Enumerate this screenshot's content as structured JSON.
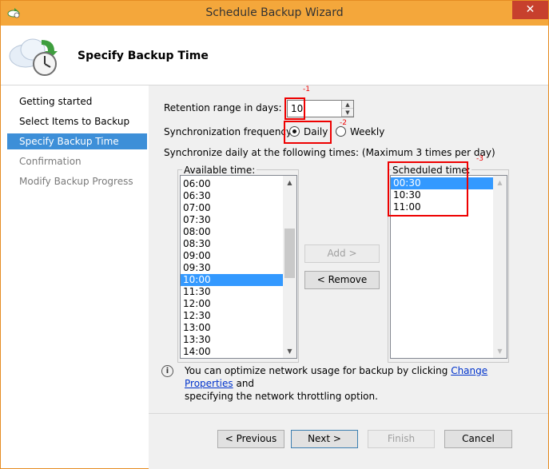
{
  "window": {
    "title": "Schedule Backup Wizard",
    "close_glyph": "✕",
    "accent": "#f4a73b"
  },
  "header": {
    "title": "Specify Backup Time"
  },
  "nav": {
    "items": [
      {
        "label": "Getting started"
      },
      {
        "label": "Select Items to Backup"
      },
      {
        "label": "Specify Backup Time"
      },
      {
        "label": "Confirmation"
      },
      {
        "label": "Modify Backup Progress"
      }
    ]
  },
  "form": {
    "retention_label": "Retention range in days:",
    "retention_value": "10",
    "sync_label": "Synchronization frequency:",
    "daily_label": "Daily",
    "weekly_label": "Weekly",
    "sync_times_label": "Synchronize daily at the following times: (Maximum 3 times per day)",
    "annotations": {
      "n1": "-1",
      "n2": "-2",
      "n3": "-3"
    }
  },
  "available": {
    "label": "Available time:",
    "items": [
      "06:00",
      "06:30",
      "07:00",
      "07:30",
      "08:00",
      "08:30",
      "09:00",
      "09:30",
      "10:00",
      "11:30",
      "12:00",
      "12:30",
      "13:00",
      "13:30",
      "14:00"
    ],
    "selected": "10:00"
  },
  "scheduled": {
    "label": "Scheduled time:",
    "items": [
      "00:30",
      "10:30",
      "11:00"
    ],
    "selected": "00:30"
  },
  "buttons": {
    "add": "Add >",
    "remove": "< Remove",
    "previous": "< Previous",
    "next": "Next >",
    "finish": "Finish",
    "cancel": "Cancel"
  },
  "info": {
    "text_before": "You can optimize network usage for backup by clicking ",
    "link": "Change Properties",
    "text_after": " and",
    "line2": "specifying the network throttling option."
  }
}
